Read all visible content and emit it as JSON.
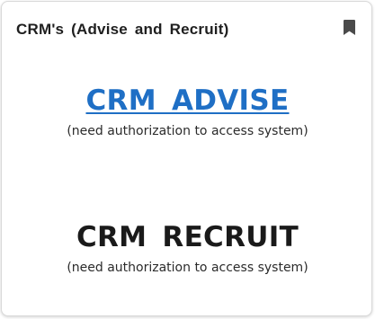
{
  "card": {
    "title": "CRM's (Advise and Recruit)",
    "bookmark_icon": "bookmark-icon"
  },
  "links": [
    {
      "label": "CRM ADVISE",
      "note": "(need authorization to access system)",
      "color": "#1f6fc5"
    },
    {
      "label": "CRM RECRUIT",
      "note": "(need authorization to access system)",
      "color": "#1a1a1a"
    }
  ]
}
